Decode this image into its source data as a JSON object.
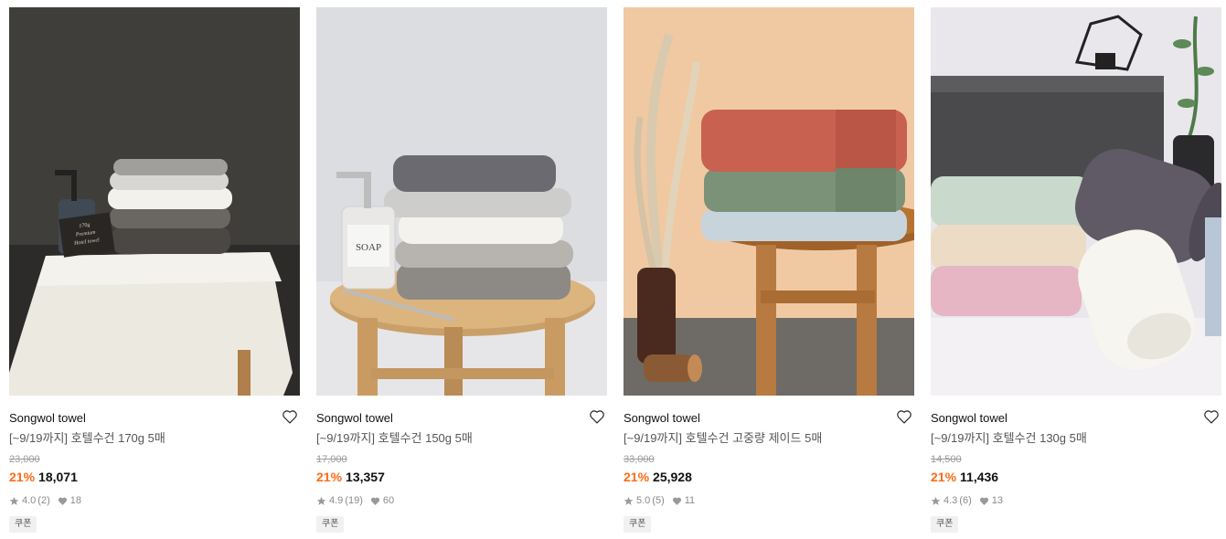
{
  "products": [
    {
      "brand": "Songwol towel",
      "title": "[~9/19까지] 호텔수건 170g 5매",
      "original_price": "23,000",
      "discount": "21%",
      "sale_price": "18,071",
      "rating": "4.0",
      "reviews": "(2)",
      "likes": "18",
      "badge": "쿠폰",
      "image_label": [
        "170g",
        "Premium",
        "Hotel towel"
      ]
    },
    {
      "brand": "Songwol towel",
      "title": "[~9/19까지] 호텔수건 150g 5매",
      "original_price": "17,000",
      "discount": "21%",
      "sale_price": "13,357",
      "rating": "4.9",
      "reviews": "(19)",
      "likes": "60",
      "badge": "쿠폰",
      "image_label": [
        "SOAP"
      ]
    },
    {
      "brand": "Songwol towel",
      "title": "[~9/19까지] 호텔수건 고중량 제이드 5매",
      "original_price": "33,000",
      "discount": "21%",
      "sale_price": "25,928",
      "rating": "5.0",
      "reviews": "(5)",
      "likes": "11",
      "badge": "쿠폰"
    },
    {
      "brand": "Songwol towel",
      "title": "[~9/19까지] 호텔수건 130g 5매",
      "original_price": "14,500",
      "discount": "21%",
      "sale_price": "11,436",
      "rating": "4.3",
      "reviews": "(6)",
      "likes": "13",
      "badge": "쿠폰"
    }
  ],
  "icons": {
    "wishlist": "heart-outline-icon",
    "rating": "star-icon",
    "likes": "heart-filled-icon"
  },
  "colors": {
    "discount": "#ff6a16",
    "meta_text": "#8a8a8a",
    "badge_bg": "#f1f1f1"
  }
}
